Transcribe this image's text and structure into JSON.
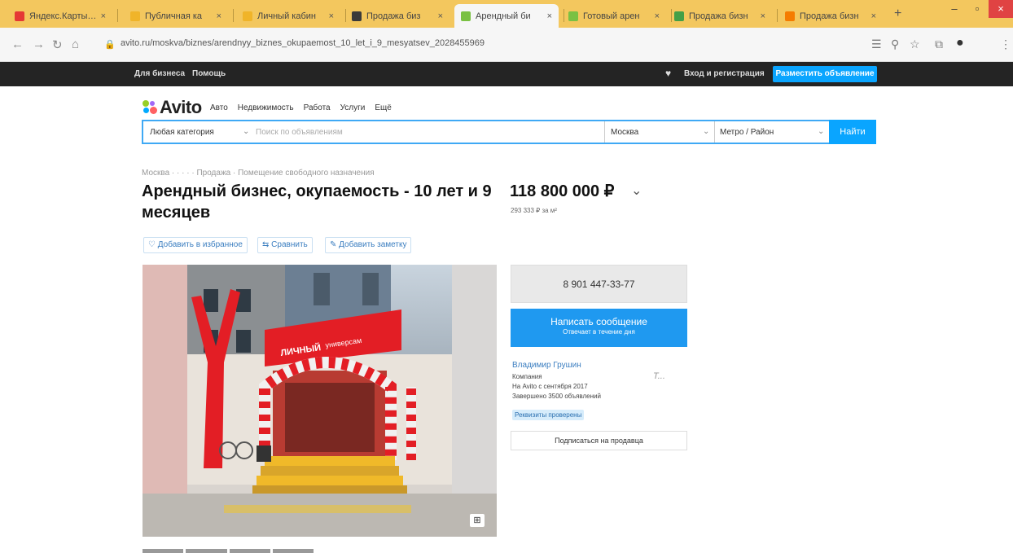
{
  "browser": {
    "tabs": [
      {
        "title": "Яндекс.Карты — в",
        "favicon_color": "#e53935"
      },
      {
        "title": "Публичная ка",
        "favicon_color": "#f0b429"
      },
      {
        "title": "Личный кабин",
        "favicon_color": "#f0b429"
      },
      {
        "title": "Продажа биз",
        "favicon_color": "#3a3a3a"
      },
      {
        "title": "Арендный би",
        "favicon_color": "#7ac143"
      },
      {
        "title": "Готовый арен",
        "favicon_color": "#7ac143"
      },
      {
        "title": "Продажа бизн",
        "favicon_color": "#43a047"
      },
      {
        "title": "Продажа бизн",
        "favicon_color": "#f57c00"
      }
    ],
    "active_tab_index": 4,
    "new_tab_label": "+",
    "url": "avito.ru/moskva/biznes/arendnyy_biznes_okupaemost_10_let_i_9_mesyatsev_2028455969",
    "window_controls": {
      "minimize": "–",
      "maximize": "▫",
      "close": "×"
    }
  },
  "avito_header": {
    "for_business": "Для бизнеса",
    "help": "Помощь",
    "login": "Вход и регистрация",
    "post_ad": "Разместить объявление"
  },
  "logo": {
    "text": "Avito"
  },
  "category_nav": [
    "Авто",
    "Недвижимость",
    "Работа",
    "Услуги",
    "Ещё"
  ],
  "search": {
    "category": "Любая категория",
    "placeholder": "Поиск по объявлениям",
    "city": "Москва",
    "metro": "Метро / Район",
    "find": "Найти"
  },
  "breadcrumb": "Москва · · · · · Продажа · Помещение свободного назначения",
  "listing": {
    "title": "Арендный бизнес, окупаемость - 10 лет и 9 месяцев",
    "price": "118 800 000 ₽",
    "price_per_m2": "293 333 ₽ за м²",
    "actions": {
      "favorite": "Добавить в избранное",
      "compare": "Сравнить",
      "note": "Добавить заметку"
    }
  },
  "contact": {
    "phone": "8 901 447-33-77",
    "message_title": "Написать сообщение",
    "message_sub": "Отвечает в течение дня",
    "seller_name": "Владимир Грушин",
    "seller_type": "Компания",
    "on_avito_since": "На Avito с сентября 2017",
    "completed": "Завершено 3500 объявлений",
    "verified": "Реквизиты проверены",
    "subscribe": "Подписаться на продавца",
    "seller_logo": "Т..."
  },
  "icons": {
    "gallery": "gallery-icon",
    "back": "arrow-left-icon",
    "forward": "arrow-right-icon",
    "reload": "reload-icon"
  }
}
